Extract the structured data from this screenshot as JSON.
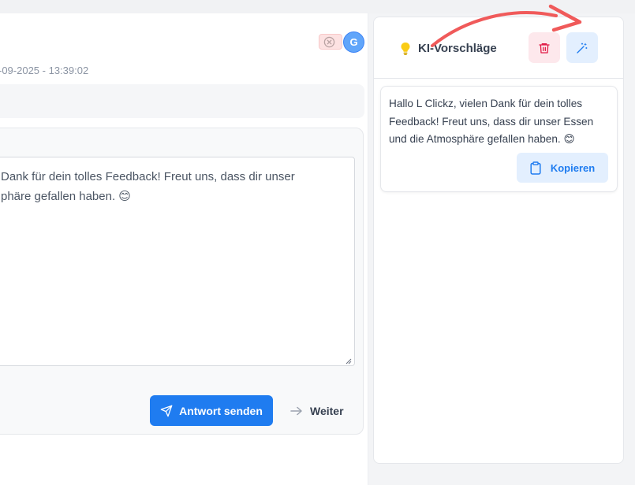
{
  "main": {
    "datetime": "-09-2025 - 13:39:02",
    "avatar_letter": "G",
    "reply_text": "Dank für dein tolles Feedback! Freut uns, dass dir unser\nphäre gefallen haben. 😊",
    "send_label": "Antwort senden",
    "next_label": "Weiter"
  },
  "ai_panel": {
    "title": "KI-Vorschläge",
    "suggestion_text": "Hallo L Clickz, vielen Dank für dein tolles Feedback! Freut uns, dass dir unser Essen und die Atmosphäre gefallen haben. 😊",
    "copy_label": "Kopieren"
  },
  "icons": [
    "close-circle-icon",
    "lightbulb-icon",
    "trash-icon",
    "magic-wand-icon",
    "clipboard-icon",
    "send-icon",
    "arrow-right-icon",
    "resize-handle-icon"
  ],
  "colors": {
    "primary": "#1f7cf0",
    "delete_bg": "#fde8ec",
    "delete_icon": "#e11d48",
    "generate_bg": "#e3effe",
    "bulb": "#facc15",
    "annotation_arrow": "#f05a5a"
  }
}
